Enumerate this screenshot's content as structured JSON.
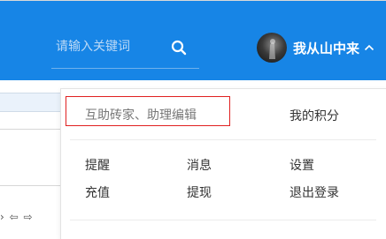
{
  "header": {
    "search": {
      "placeholder": "请输入关键词"
    },
    "user": {
      "name": "我从山中来"
    }
  },
  "left_panel": {
    "pager_icons": [
      "chevron-left-icon",
      "hollow-arrow-left-icon",
      "hollow-arrow-right-icon"
    ]
  },
  "dropdown": {
    "highlighted_item": "互助砖家、助理编辑",
    "my_points": "我的积分",
    "menu": [
      {
        "label": "提醒"
      },
      {
        "label": "消息"
      },
      {
        "label": "设置"
      },
      {
        "label": "充值"
      },
      {
        "label": "提现"
      },
      {
        "label": "退出登录"
      }
    ]
  },
  "colors": {
    "header_bg": "#1785e6",
    "highlight_border": "#e02020",
    "text": "#333333"
  }
}
